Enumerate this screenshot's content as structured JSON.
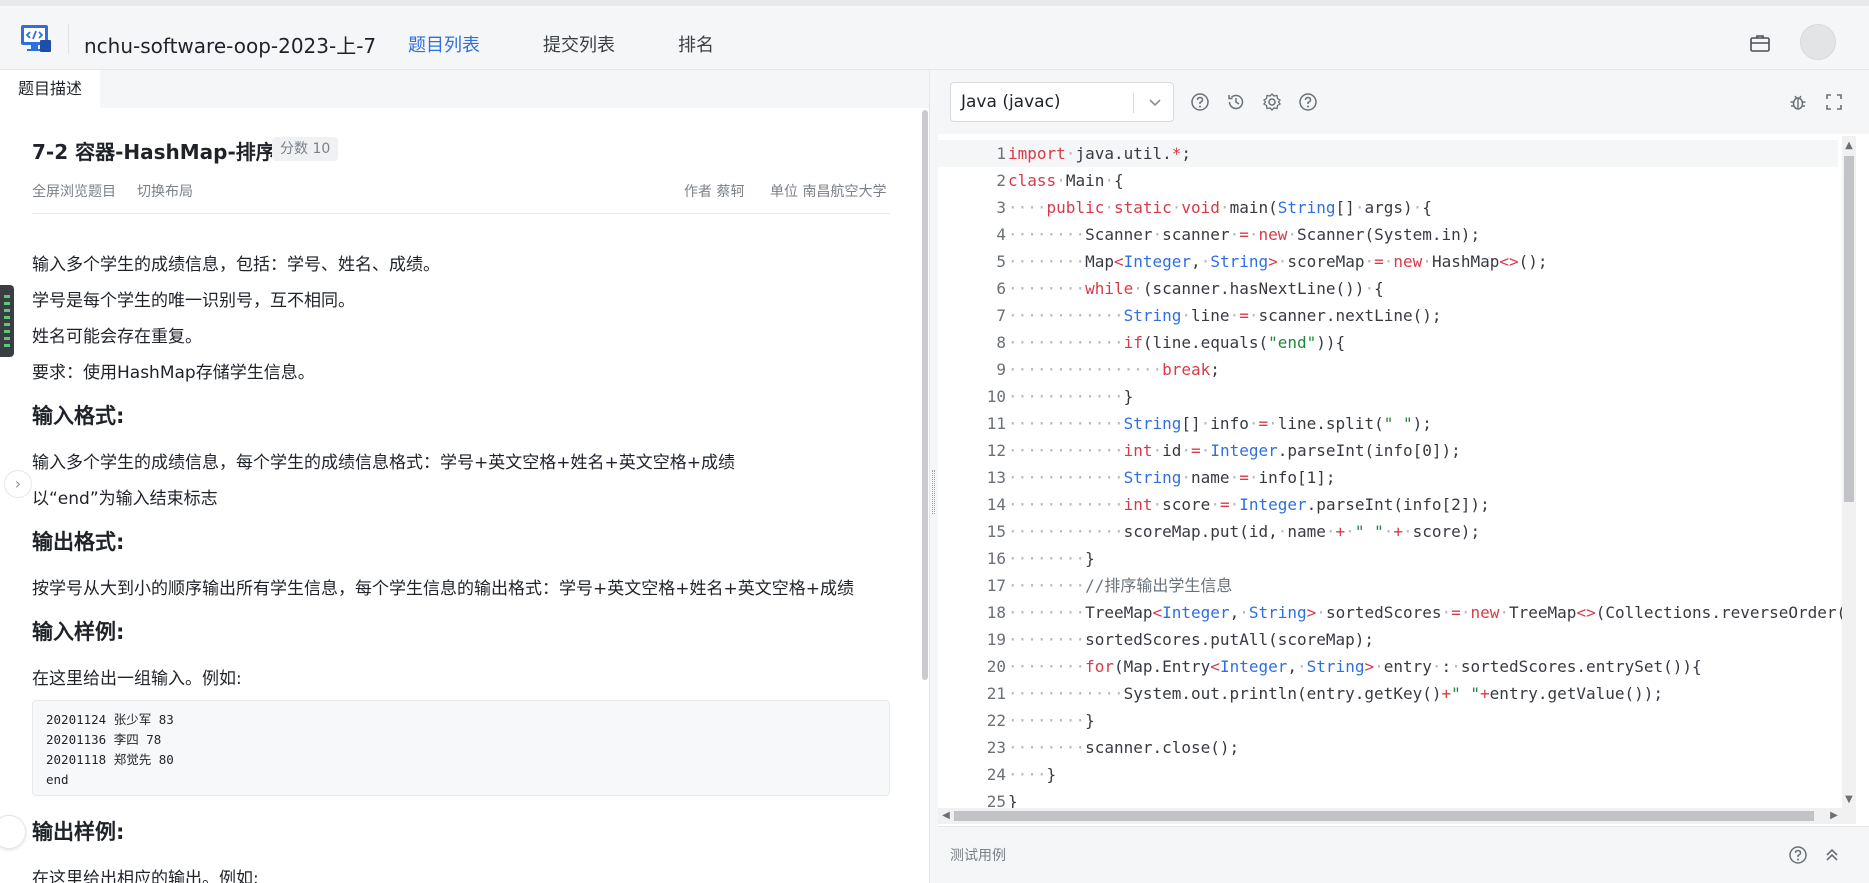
{
  "colors": {
    "accent": "#2f6fe0",
    "keyword": "#d73a49",
    "type": "#2f6fe0",
    "string": "#22863a",
    "comment": "#6a737d"
  },
  "header": {
    "course_title": "nchu-software-oop-2023-上-7",
    "tabs": [
      {
        "label": "题目列表",
        "active": true
      },
      {
        "label": "提交列表",
        "active": false
      },
      {
        "label": "排名",
        "active": false
      }
    ],
    "icons": [
      "monitor-code-logo-icon",
      "briefcase-icon",
      "avatar"
    ]
  },
  "problem": {
    "tab_label": "题目描述",
    "title": "7-2 容器-HashMap-排序",
    "score_badge": "分数 10",
    "links": {
      "fullscreen": "全屏浏览题目",
      "layout": "切换布局"
    },
    "author": "作者 蔡轲",
    "unit": "单位 南昌航空大学",
    "description": [
      "输入多个学生的成绩信息，包括：学号、姓名、成绩。",
      "学号是每个学生的唯一识别号，互不相同。",
      "姓名可能会存在重复。",
      "要求：使用HashMap存储学生信息。"
    ],
    "input_heading": "输入格式:",
    "input_lines": [
      "输入多个学生的成绩信息，每个学生的成绩信息格式：学号+英文空格+姓名+英文空格+成绩",
      "以“end”为输入结束标志"
    ],
    "output_heading": "输出格式:",
    "output_lines": [
      "按学号从大到小的顺序输出所有学生信息，每个学生信息的输出格式：学号+英文空格+姓名+英文空格+成绩"
    ],
    "sample_input_heading": "输入样例:",
    "sample_input_intro": "在这里给出一组输入。例如:",
    "sample_input": [
      "20201124 张少军 83",
      "20201136 李四 78",
      "20201118 郑觉先 80",
      "end"
    ],
    "sample_output_heading": "输出样例:",
    "sample_output_intro": "在这里给出相应的输出。例如:"
  },
  "editor": {
    "language": "Java (javac)",
    "toolbar_icons": [
      "help-circle-icon",
      "history-icon",
      "settings-gear-icon",
      "question-icon",
      "bug-debug-icon",
      "fullscreen-expand-icon"
    ],
    "line_numbers": [
      "1",
      "2",
      "3",
      "4",
      "5",
      "6",
      "7",
      "8",
      "9",
      "10",
      "11",
      "12",
      "13",
      "14",
      "15",
      "16",
      "17",
      "18",
      "19",
      "20",
      "21",
      "22",
      "23",
      "24",
      "25"
    ],
    "current_line": 1,
    "code_lines": [
      "import java.util.*;",
      "class Main {",
      "    public static void main(String[] args) {",
      "        Scanner scanner = new Scanner(System.in);",
      "        Map<Integer, String> scoreMap = new HashMap<>();",
      "        while (scanner.hasNextLine()) {",
      "            String line = scanner.nextLine();",
      "            if(line.equals(\"end\")){",
      "                break;",
      "            }",
      "            String[] info = line.split(\" \");",
      "            int id = Integer.parseInt(info[0]);",
      "            String name = info[1];",
      "            int score = Integer.parseInt(info[2]);",
      "            scoreMap.put(id, name + \" \" + score);",
      "        }",
      "        //排序输出学生信息",
      "        TreeMap<Integer, String> sortedScores = new TreeMap<>(Collections.reverseOrder()",
      "        sortedScores.putAll(scoreMap);",
      "        for(Map.Entry<Integer, String> entry : sortedScores.entrySet()){",
      "            System.out.println(entry.getKey()+\" \"+entry.getValue());",
      "        }",
      "        scanner.close();",
      "    }",
      "}"
    ]
  },
  "testcase": {
    "label": "测试用例",
    "icons": [
      "help-circle-icon",
      "chevron-double-up-icon"
    ]
  }
}
